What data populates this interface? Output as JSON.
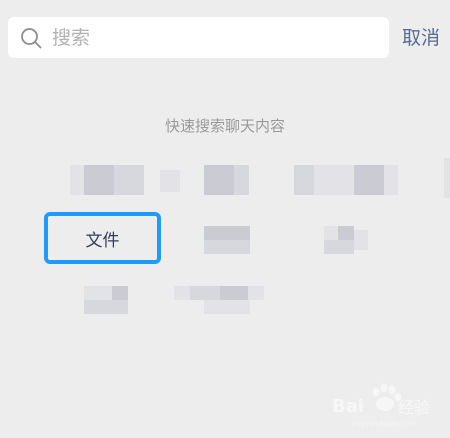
{
  "search": {
    "placeholder": "搜索",
    "value": "",
    "cancel_label": "取消"
  },
  "quick_search": {
    "title": "快速搜索聊天内容",
    "options": [
      {
        "label": "文件",
        "highlighted": true
      }
    ]
  },
  "colors": {
    "background": "#ededed",
    "accent_link": "#576b95",
    "highlight_border": "#1e9bff",
    "muted_text": "#9a9a9a"
  },
  "icons": {
    "search": "search-icon",
    "watermark": "baidu-jingyan-logo"
  },
  "watermark": {
    "text": "Baidu 经验"
  }
}
